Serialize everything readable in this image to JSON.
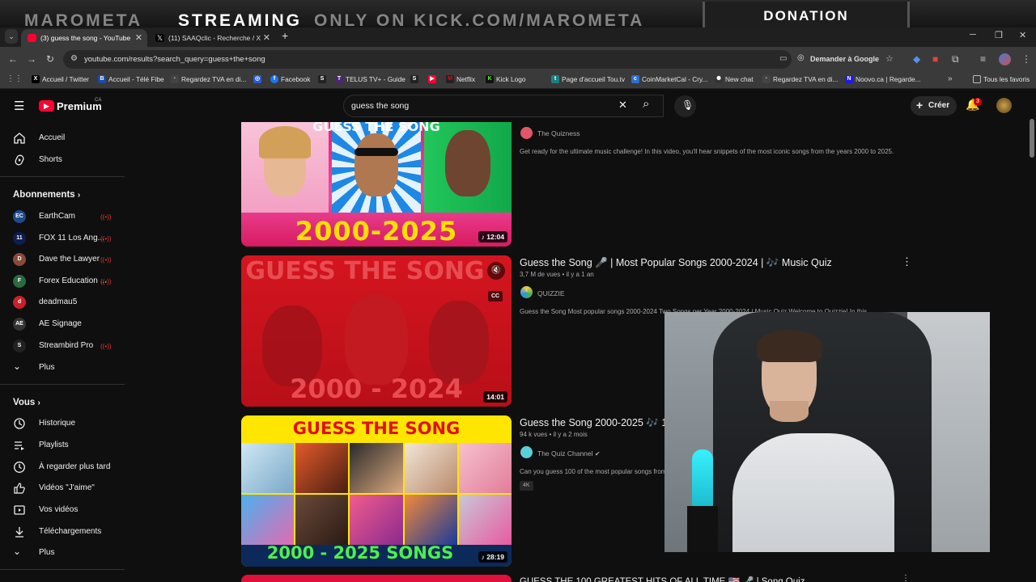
{
  "stream_banner": {
    "left_text": "MAROMETA",
    "streaming": "STREAMING",
    "only_on": "ONLY ON KICK.COM/MAROMETA",
    "donation": "DONATION"
  },
  "browser": {
    "tabs": [
      {
        "label": "(3) guess the song - YouTube",
        "active": true
      },
      {
        "label": "(11) SAAQclic - Recherche / X",
        "active": false
      }
    ],
    "url": "youtube.com/results?search_query=guess+the+song",
    "ask_google": "Demander à Google",
    "bookmarks": [
      {
        "label": "Accueil / Twitter",
        "icon": "X"
      },
      {
        "label": "Accueil - Télé Fibe",
        "icon": "B"
      },
      {
        "label": "Regardez TVA en di...",
        "icon": "tva"
      },
      {
        "label": "",
        "icon": "globe"
      },
      {
        "label": "Facebook",
        "icon": "f"
      },
      {
        "label": "",
        "icon": "S"
      },
      {
        "label": "TELUS TV+ - Guide",
        "icon": "T"
      },
      {
        "label": "",
        "icon": "S"
      },
      {
        "label": "",
        "icon": "yt"
      },
      {
        "label": "Netflix",
        "icon": "M"
      },
      {
        "label": "Kick Logo",
        "icon": "K"
      },
      {
        "label": "Page d'accueil Tou.tv",
        "icon": "tou"
      },
      {
        "label": "CoinMarketCal - Cry...",
        "icon": "cmc"
      },
      {
        "label": "New chat",
        "icon": "gpt"
      },
      {
        "label": "Regardez TVA en di...",
        "icon": "tva"
      },
      {
        "label": "Noovo.ca | Regarde...",
        "icon": "N"
      }
    ],
    "all_bookmarks": "Tous les favoris"
  },
  "youtube": {
    "logo_text": "Premium",
    "country": "CA",
    "search_value": "guess the song",
    "create_label": "Créer",
    "notif_count": "3",
    "sidebar": {
      "main": [
        {
          "label": "Accueil",
          "icon": "home-icon"
        },
        {
          "label": "Shorts",
          "icon": "shorts-icon"
        }
      ],
      "subs_header": "Abonnements",
      "subs": [
        {
          "label": "EarthCam",
          "color": "#1f4a8a",
          "init": "EC"
        },
        {
          "label": "FOX 11 Los Ang...",
          "color": "#0d1e52",
          "init": "11"
        },
        {
          "label": "Dave the Lawyer",
          "color": "#8a4a3a",
          "init": "D"
        },
        {
          "label": "Forex Education ...",
          "color": "#2a6b3f",
          "init": "F"
        },
        {
          "label": "deadmau5",
          "color": "#cc1f2a",
          "init": "d"
        },
        {
          "label": "AE Signage",
          "color": "#333333",
          "init": "AE"
        },
        {
          "label": "Streambird Pro",
          "color": "#222222",
          "init": "S"
        }
      ],
      "subs_more": "Plus",
      "you_header": "Vous",
      "you": [
        {
          "label": "Historique",
          "icon": "history-icon"
        },
        {
          "label": "Playlists",
          "icon": "playlists-icon"
        },
        {
          "label": "À regarder plus tard",
          "icon": "watch-later-icon"
        },
        {
          "label": "Vidéos \"J'aime\"",
          "icon": "like-icon"
        },
        {
          "label": "Vos vidéos",
          "icon": "your-videos-icon"
        },
        {
          "label": "Téléchargements",
          "icon": "download-icon"
        }
      ],
      "you_more": "Plus"
    },
    "results": [
      {
        "title": "",
        "channel": "The Quizness",
        "description": "Get ready for the ultimate music challenge! In this video, you'll hear snippets of the most iconic songs from the years 2000 to 2025.",
        "duration": "12:04",
        "thumb_text": "2000-2025",
        "thumb_top": "GUESS THE SONG"
      },
      {
        "title": "Guess the Song 🎤 | Most Popular Songs 2000-2024 | 🎶 Music Quiz",
        "meta": "3,7 M de vues • il y a 1 an",
        "channel": "QUIZZIE",
        "description": "Guess the Song Most popular songs 2000-2024 Two Songs per Year 2000-2024 | Music Quiz Welcome to Quizzie! In this",
        "duration": "14:01",
        "thumb_top": "GUESS THE SONG",
        "thumb_text": "2000 - 2024",
        "cc": "CC"
      },
      {
        "title": "Guess the Song 2000-2025 🎶 10",
        "meta": "94 k vues • il y a 2 mois",
        "channel": "The Quiz Channel",
        "description": "Can you guess 100 of the most popular songs from",
        "badge": "4K",
        "duration": "28:19",
        "thumb_top": "GUESS THE SONG",
        "thumb_text": "2000 - 2025 SONGS"
      },
      {
        "title": "GUESS THE 100 GREATEST HITS OF ALL TIME 🇺🇸 🎤 | Song Quiz"
      }
    ]
  }
}
